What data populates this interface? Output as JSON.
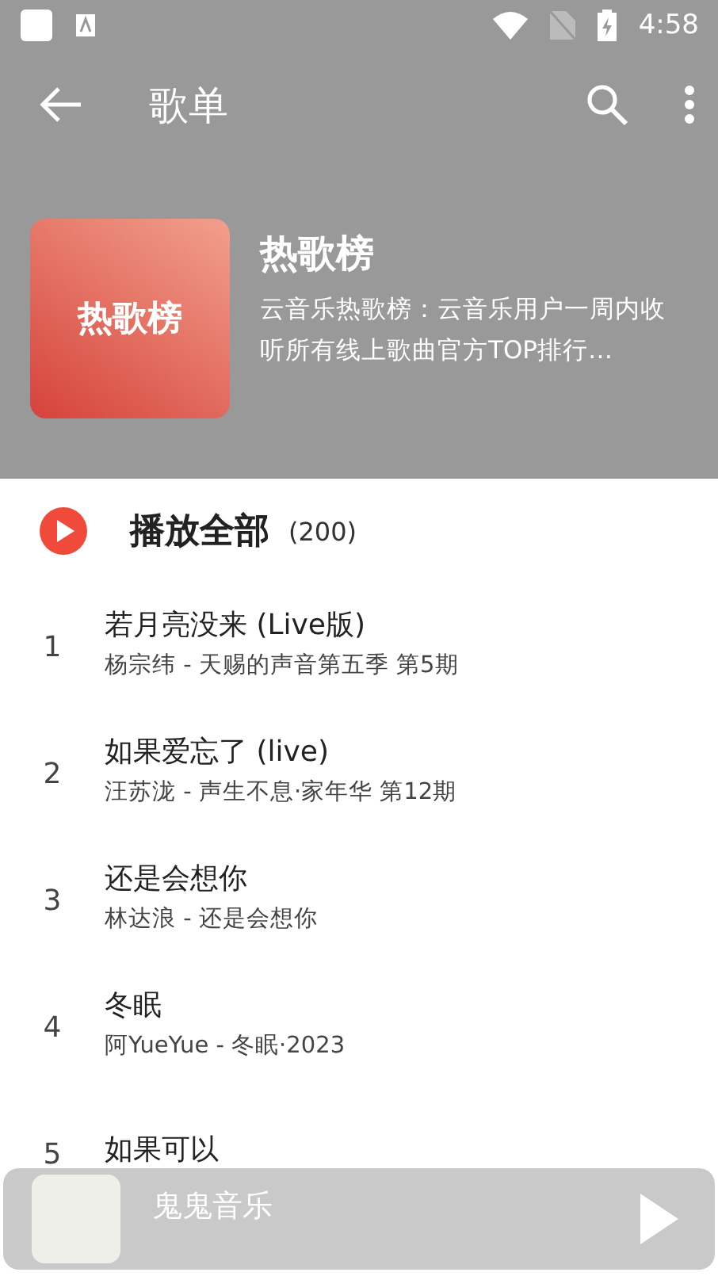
{
  "status_bar": {
    "time": "4:58"
  },
  "toolbar": {
    "title": "歌单"
  },
  "playlist": {
    "cover_text": "热歌榜",
    "name": "热歌榜",
    "description": "云音乐热歌榜：云音乐用户一周内收听所有线上歌曲官方TOP排行…"
  },
  "play_all": {
    "label": "播放全部",
    "count": "(200)"
  },
  "songs": [
    {
      "index": "1",
      "title": "若月亮没来 (Live版)",
      "subtitle": "杨宗纬 - 天赐的声音第五季 第5期"
    },
    {
      "index": "2",
      "title": "如果爱忘了 (live)",
      "subtitle": "汪苏泷 - 声生不息·家年华 第12期"
    },
    {
      "index": "3",
      "title": "还是会想你",
      "subtitle": "林达浪 - 还是会想你"
    },
    {
      "index": "4",
      "title": "冬眠",
      "subtitle": "阿YueYue - 冬眠·2023"
    },
    {
      "index": "5",
      "title": "如果可以"
    }
  ],
  "player": {
    "title": "鬼鬼音乐"
  }
}
